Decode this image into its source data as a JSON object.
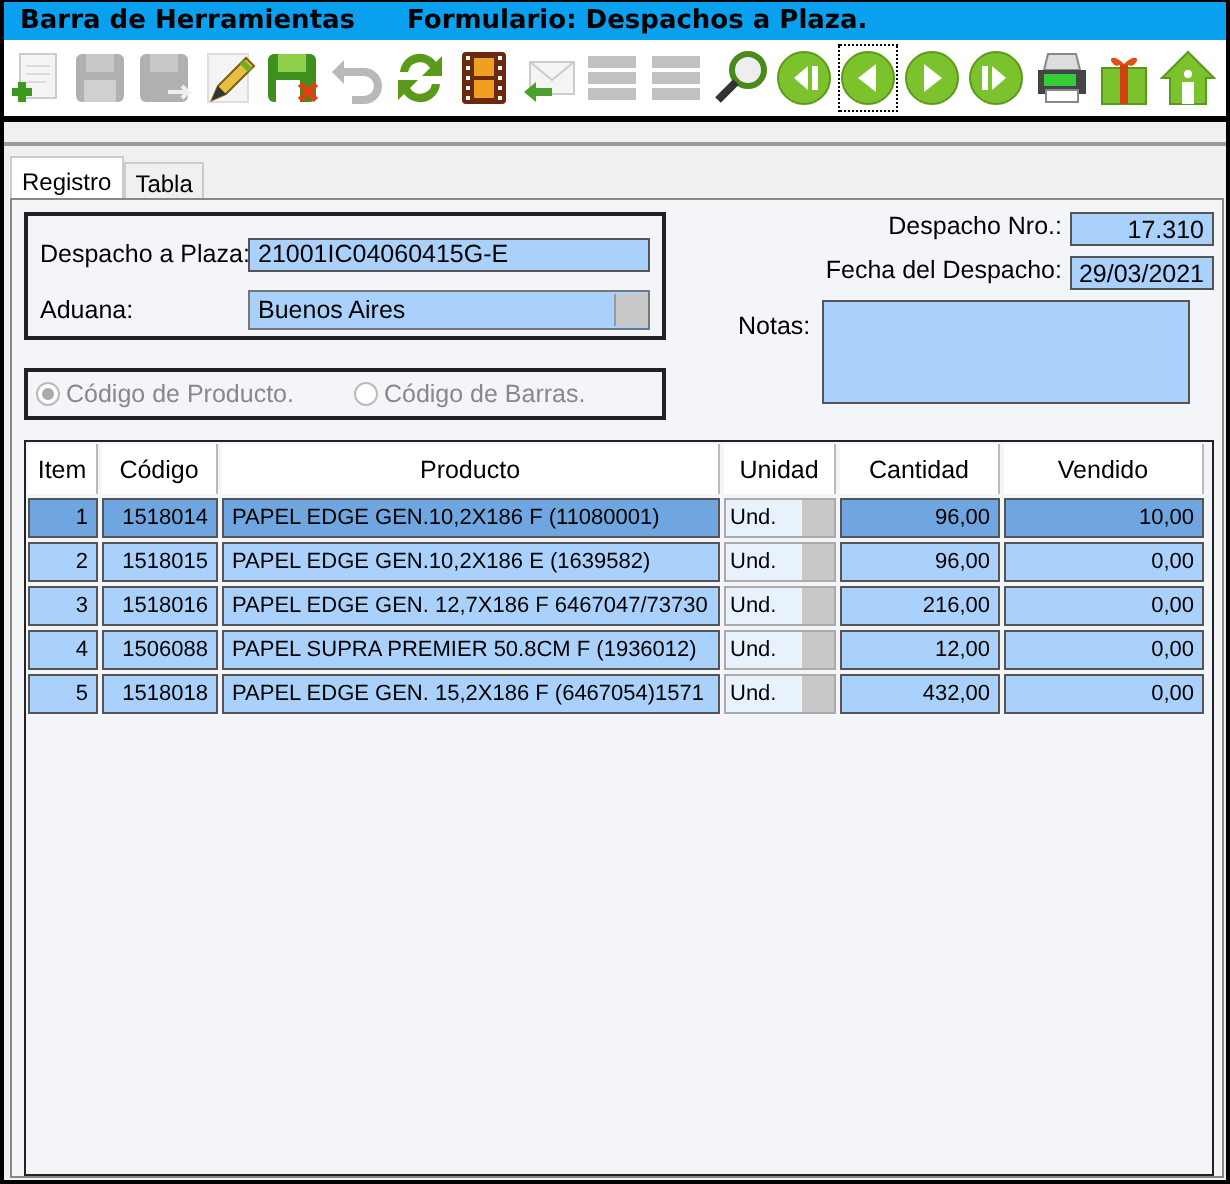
{
  "window": {
    "title": "Barra de Herramientas",
    "form_title": "Formulario: Despachos a Plaza."
  },
  "toolbar": [
    {
      "kind": "new",
      "disabled": false,
      "focused": false
    },
    {
      "kind": "save",
      "disabled": true,
      "focused": false
    },
    {
      "kind": "save-as",
      "disabled": true,
      "focused": false
    },
    {
      "kind": "edit",
      "disabled": false,
      "focused": false
    },
    {
      "kind": "cancel",
      "disabled": false,
      "focused": false
    },
    {
      "kind": "undo",
      "disabled": true,
      "focused": false
    },
    {
      "kind": "refresh",
      "disabled": false,
      "focused": false
    },
    {
      "kind": "film",
      "disabled": false,
      "focused": false
    },
    {
      "kind": "mail",
      "disabled": false,
      "focused": false
    },
    {
      "kind": "list",
      "disabled": true,
      "focused": false
    },
    {
      "kind": "list",
      "disabled": true,
      "focused": false
    },
    {
      "kind": "search",
      "disabled": false,
      "focused": false
    },
    {
      "kind": "first",
      "disabled": false,
      "focused": false
    },
    {
      "kind": "prev",
      "disabled": false,
      "focused": true
    },
    {
      "kind": "next",
      "disabled": false,
      "focused": false
    },
    {
      "kind": "last",
      "disabled": false,
      "focused": false
    },
    {
      "kind": "print",
      "disabled": false,
      "focused": false
    },
    {
      "kind": "gift",
      "disabled": false,
      "focused": false
    },
    {
      "kind": "home",
      "disabled": false,
      "focused": false
    }
  ],
  "tabs": [
    {
      "label": "Registro",
      "selected": true
    },
    {
      "label": "Tabla",
      "selected": false
    }
  ],
  "form": {
    "despacho_label": "Despacho a Plaza:",
    "despacho_value": "21001IC04060415G-E",
    "aduana_label": "Aduana:",
    "aduana_value": "Buenos Aires",
    "nro_label": "Despacho Nro.:",
    "nro_value": "17.310",
    "fecha_label": "Fecha del Despacho:",
    "fecha_value": "29/03/2021",
    "notas_label": "Notas:"
  },
  "search_mode": [
    {
      "label": "Código de Producto.",
      "selected": true,
      "disabled": true
    },
    {
      "label": "Código de Barras.",
      "selected": false,
      "disabled": true
    }
  ],
  "table": {
    "columns": [
      "Item",
      "Código",
      "Producto",
      "Unidad",
      "Cantidad",
      "Vendido"
    ],
    "rows": [
      {
        "item": "1",
        "codigo": "1518014",
        "producto": "PAPEL EDGE GEN.10,2X186 F  (11080001)",
        "unidad": "Und.",
        "cantidad": "96,00",
        "vendido": "10,00",
        "selected": true
      },
      {
        "item": "2",
        "codigo": "1518015",
        "producto": "PAPEL EDGE GEN.10,2X186 E (1639582)",
        "unidad": "Und.",
        "cantidad": "96,00",
        "vendido": "0,00",
        "selected": false
      },
      {
        "item": "3",
        "codigo": "1518016",
        "producto": "PAPEL EDGE GEN. 12,7X186 F 6467047/73730",
        "unidad": "Und.",
        "cantidad": "216,00",
        "vendido": "0,00",
        "selected": false
      },
      {
        "item": "4",
        "codigo": "1506088",
        "producto": "PAPEL SUPRA PREMIER 50.8CM F (1936012)",
        "unidad": "Und.",
        "cantidad": "12,00",
        "vendido": "0,00",
        "selected": false
      },
      {
        "item": "5",
        "codigo": "1518018",
        "producto": "PAPEL EDGE  GEN. 15,2X186 F (6467054)1571",
        "unidad": "Und.",
        "cantidad": "432,00",
        "vendido": "0,00",
        "selected": false
      }
    ]
  }
}
